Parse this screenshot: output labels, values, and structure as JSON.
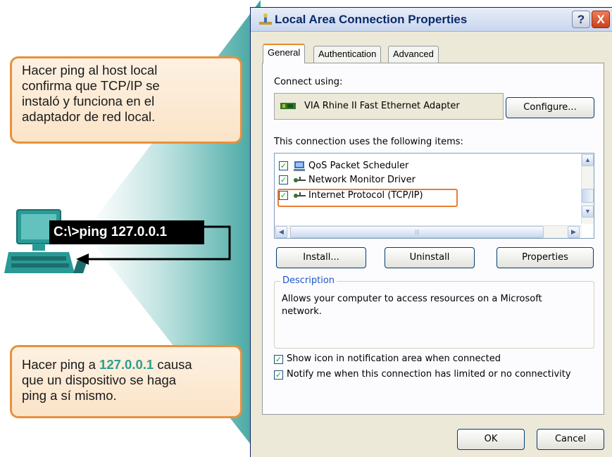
{
  "callouts": {
    "top": [
      "Hacer ping al host local",
      "confirma que TCP/IP se",
      "instaló y funciona en el",
      "adaptador de red local."
    ],
    "bottom_pre": "Hacer ping a ",
    "bottom_ip": "127.0.0.1",
    "bottom_post_1": " causa",
    "bottom_lines": [
      "que un dispositivo se haga",
      "ping a sí mismo."
    ]
  },
  "command": "C:\\>ping 127.0.0.1",
  "dialog": {
    "title": "Local Area Connection Properties",
    "help_btn": "?",
    "close_btn": "X",
    "tabs": [
      "General",
      "Authentication",
      "Advanced"
    ],
    "connect_using_label": "Connect using:",
    "adapter": "VIA Rhine II Fast Ethernet Adapter",
    "configure_btn": "Configure...",
    "items_label": "This connection uses the following items:",
    "items": [
      {
        "label": "QoS Packet Scheduler",
        "checked": true,
        "icon": "scheduler-icon"
      },
      {
        "label": "Network Monitor Driver",
        "checked": true,
        "icon": "protocol-icon"
      },
      {
        "label": "Internet Protocol (TCP/IP)",
        "checked": true,
        "icon": "protocol-icon"
      }
    ],
    "install_btn": "Install...",
    "uninstall_btn": "Uninstall",
    "properties_btn": "Properties",
    "description_title": "Description",
    "description_text": "Allows your computer to access resources on a Microsoft network.",
    "show_icon_label": "Show icon in notification area when connected",
    "notify_label": "Notify me when this connection has limited or no connectivity",
    "ok_btn": "OK",
    "cancel_btn": "Cancel"
  },
  "colors": {
    "beam": "#5bb4b0",
    "callout_border": "#e8913b",
    "highlight_border": "#ec7d32",
    "ip_text": "#2e9e8c"
  }
}
